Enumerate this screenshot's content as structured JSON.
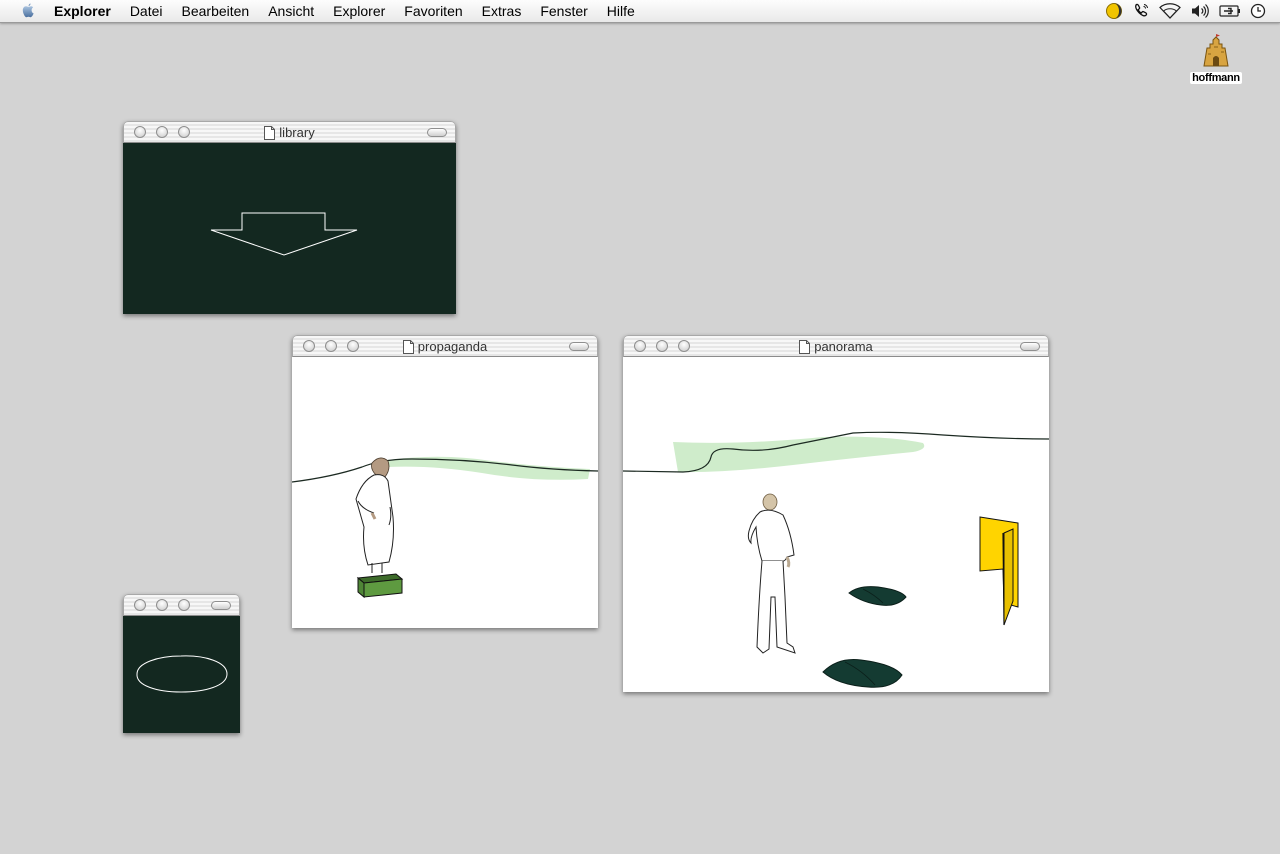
{
  "menubar": {
    "items": [
      "Explorer",
      "Datei",
      "Bearbeiten",
      "Ansicht",
      "Explorer",
      "Favoriten",
      "Extras",
      "Fenster",
      "Hilfe"
    ],
    "extras": [
      "display-moon-icon",
      "phone-icon",
      "wifi-icon",
      "volume-icon",
      "battery-icon",
      "clock-icon"
    ]
  },
  "desktop": {
    "icon_label": "hoffmann",
    "icon": "sandcastle-icon"
  },
  "windows": {
    "library": {
      "title": "library",
      "content_icon": "arrow-down-outline-icon"
    },
    "propaganda": {
      "title": "propaganda"
    },
    "panorama": {
      "title": "panorama"
    },
    "small": {
      "title": "",
      "content_icon": "ellipse-outline-icon"
    }
  },
  "colors": {
    "desktop": "#d3d3d3",
    "dark_content": "#132820",
    "accent_yellow": "#ffd400",
    "box_green": "#5e9a40",
    "hill_green": "#cfeccb"
  }
}
